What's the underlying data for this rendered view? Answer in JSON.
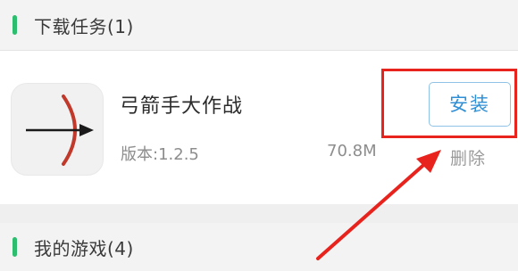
{
  "download_section": {
    "title": "下载任务(1)"
  },
  "app": {
    "name": "弓箭手大作战",
    "version": "版本:1.2.5",
    "size": "70.8M",
    "icon": "bow-and-arrow-icon"
  },
  "actions": {
    "install_label": "安装",
    "delete_label": "删除"
  },
  "games_section": {
    "title": "我的游戏(4)"
  },
  "colors": {
    "accent_green": "#2dbd6e",
    "install_blue": "#2f8fd6",
    "annotation_red": "#e8231d"
  }
}
